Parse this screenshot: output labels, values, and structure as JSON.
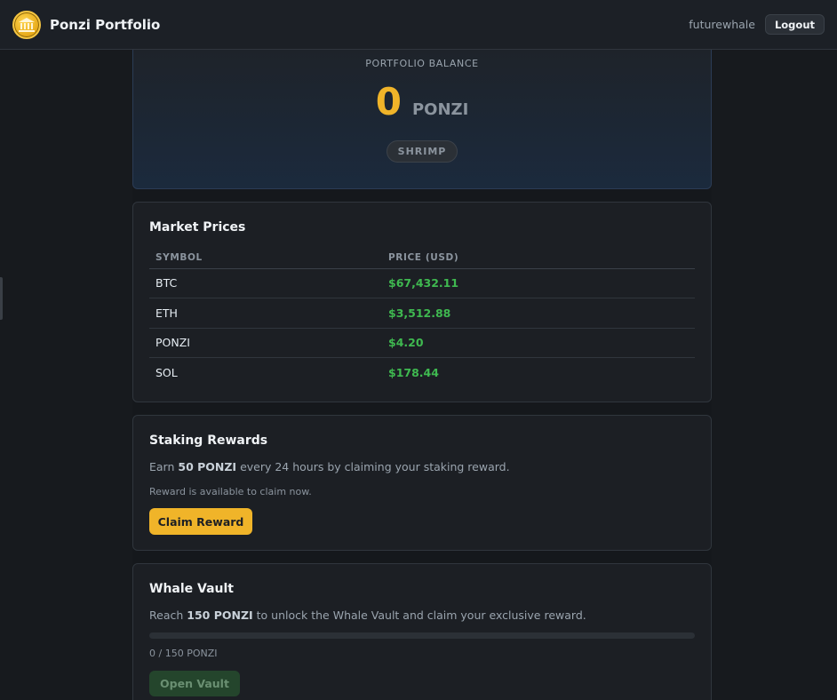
{
  "header": {
    "brand": "Ponzi Portfolio",
    "username": "futurewhale",
    "logout_label": "Logout"
  },
  "balance": {
    "label": "PORTFOLIO BALANCE",
    "amount": "0",
    "unit": "PONZI",
    "tier": "SHRIMP"
  },
  "market": {
    "title": "Market Prices",
    "columns": [
      "SYMBOL",
      "PRICE (USD)"
    ],
    "rows": [
      {
        "symbol": "BTC",
        "price": "$67,432.11"
      },
      {
        "symbol": "ETH",
        "price": "$3,512.88"
      },
      {
        "symbol": "PONZI",
        "price": "$4.20"
      },
      {
        "symbol": "SOL",
        "price": "$178.44"
      }
    ]
  },
  "staking": {
    "title": "Staking Rewards",
    "desc_prefix": "Earn ",
    "desc_amount": "50 PONZI",
    "desc_suffix": " every 24 hours by claiming your staking reward.",
    "note": "Reward is available to claim now.",
    "button_label": "Claim Reward"
  },
  "vault": {
    "title": "Whale Vault",
    "desc_prefix": "Reach ",
    "desc_amount": "150 PONZI",
    "desc_suffix": " to unlock the Whale Vault and claim your exclusive reward.",
    "progress_fraction": 0,
    "progress_text": "0 / 150 PONZI",
    "button_label": "Open Vault"
  },
  "colors": {
    "accent_gold": "#f0b429",
    "price_green": "#3fb950",
    "background": "#15181c",
    "card": "#1c1f24"
  }
}
